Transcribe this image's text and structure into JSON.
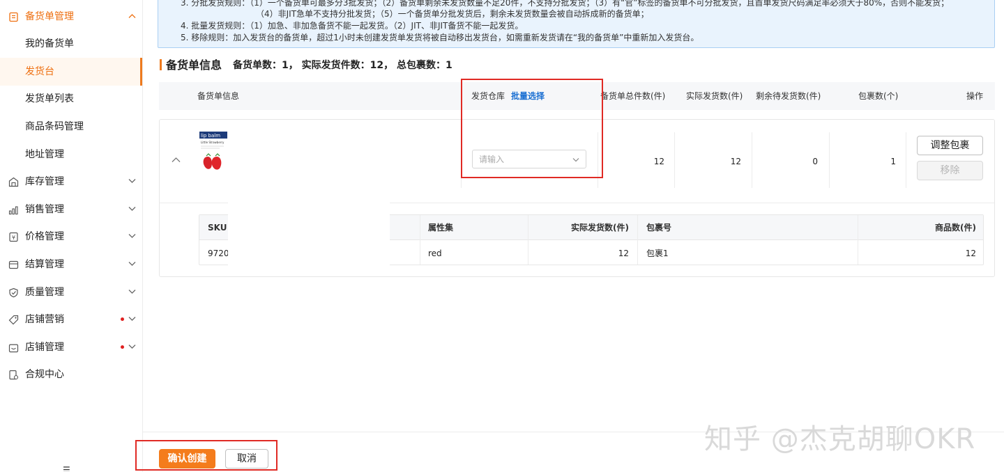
{
  "sidebar": {
    "groups": [
      {
        "label": "备货单管理",
        "icon": "order-list-icon",
        "expanded": true
      },
      {
        "label": "库存管理",
        "icon": "warehouse-icon"
      },
      {
        "label": "销售管理",
        "icon": "sales-chart-icon"
      },
      {
        "label": "价格管理",
        "icon": "price-tag-icon"
      },
      {
        "label": "结算管理",
        "icon": "wallet-icon"
      },
      {
        "label": "质量管理",
        "icon": "shield-check-icon"
      },
      {
        "label": "店铺营销",
        "icon": "marketing-tag-icon",
        "badge": true
      },
      {
        "label": "店铺管理",
        "icon": "store-icon",
        "badge": true
      },
      {
        "label": "合规中心",
        "icon": "compliance-doc-icon"
      }
    ],
    "sub_items": [
      {
        "label": "我的备货单"
      },
      {
        "label": "发货台",
        "selected": true
      },
      {
        "label": "发货单列表"
      },
      {
        "label": "商品条码管理"
      },
      {
        "label": "地址管理"
      }
    ],
    "accent_color": "#ee6f10"
  },
  "notice": {
    "line1": "3. 分批发货规则：（1）一个备货单可最多分3批发货；（2）备货单剩余未发货数量不足20件，不支持分批发货；（3）有“官”标签的备货单不可分批发货，且首单发货尺码满足率必须大于80%，否则不能发货；",
    "line2": "（4）非JIT急单不支持分批发货；（5）一个备货单分批发货后，剩余未发货数量会被自动拆成新的备货单；",
    "line3": "4. 批量发货规则：（1）加急、非加急备货不能一起发货。（2）JIT、非JIT备货不能一起发货。",
    "line4": "5. 移除规则：加入发货台的备货单，超过1小时未创建发货单发货将被自动移出发货台，如需重新发货请在“我的备货单”中重新加入发货台。"
  },
  "section": {
    "title": "备货单信息",
    "stats": "备货单数：1，  实际发货件数：12，  总包裹数：1"
  },
  "table": {
    "headers": {
      "info": "备货单信息",
      "warehouse": "发货仓库",
      "batch_select": "批量选择",
      "total": "备货单总件数(件)",
      "actual": "实际发货数(件)",
      "remaining": "剩余待发货数(件)",
      "packages": "包裹数(个)",
      "actions": "操作"
    },
    "row": {
      "product_image_label": "lip balm",
      "product_image_sublabel": "Little Strawberry",
      "warehouse_placeholder": "请输入",
      "total": "12",
      "actual": "12",
      "remaining": "0",
      "packages": "1",
      "adjust_button": "调整包裹",
      "remove_button": "移除"
    }
  },
  "sku_table": {
    "headers": {
      "sku": "SKU",
      "attr": "属性集",
      "actual": "实际发货数(件)",
      "package_no": "包裹号",
      "goods_count": "商品数(件)"
    },
    "row": {
      "sku": "9720",
      "attr": "red",
      "actual": "12",
      "package_no": "包裹1",
      "goods_count": "12"
    }
  },
  "footer": {
    "confirm_button": "确认创建",
    "cancel_button": "取消"
  },
  "watermark": "知乎 @杰克胡聊OKR",
  "colors": {
    "primary": "#f47c1c",
    "link": "#1a6fd2",
    "highlight": "#e02a24"
  }
}
